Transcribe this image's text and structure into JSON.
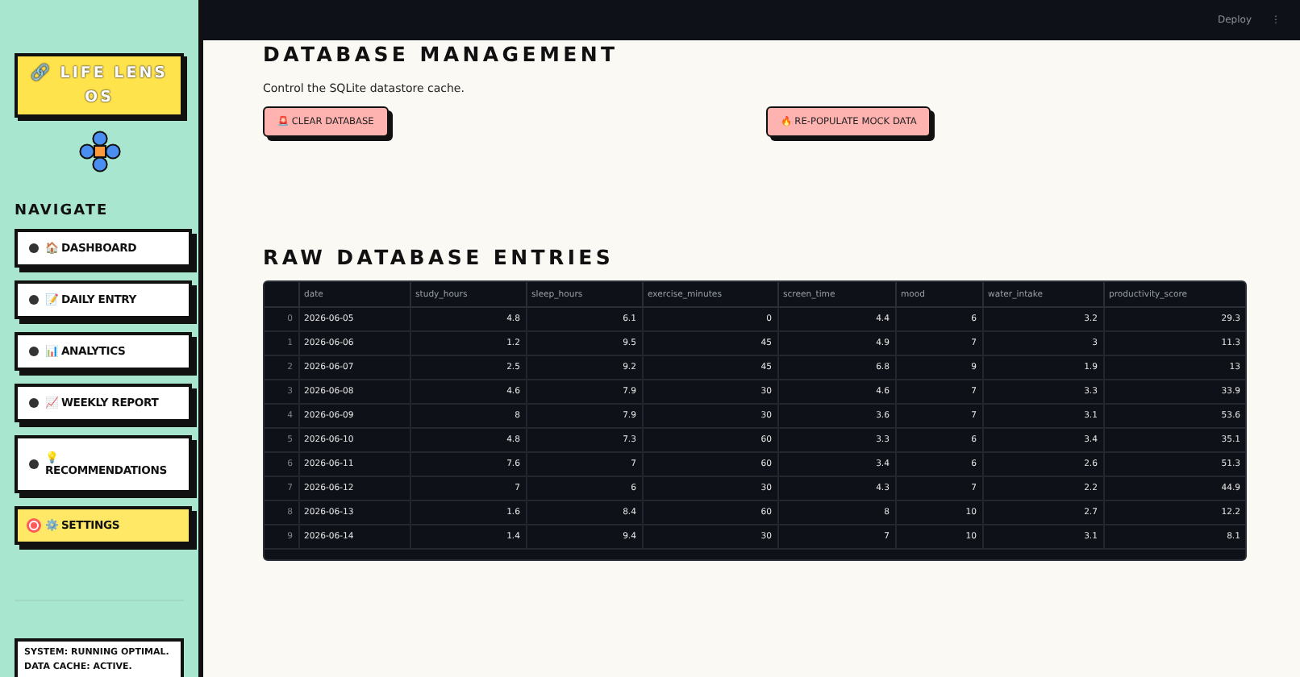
{
  "sidebar": {
    "logo": {
      "icon": "🔗",
      "title": "LIFE LENS OS"
    },
    "section_title": "NAVIGATE",
    "nav_items": [
      {
        "icon": "🏠",
        "label": "DASHBOARD",
        "selected": false
      },
      {
        "icon": "📝",
        "label": "DAILY ENTRY",
        "selected": false
      },
      {
        "icon": "📊",
        "label": "ANALYTICS",
        "selected": false
      },
      {
        "icon": "📈",
        "label": "WEEKLY REPORT",
        "selected": false
      },
      {
        "icon": "💡",
        "label": "RECOMMENDATIONS",
        "selected": false
      },
      {
        "icon": "⚙️",
        "label": "SETTINGS",
        "selected": true
      }
    ],
    "status_lines": [
      "SYSTEM: RUNNING OPTIMAL.",
      "DATA CACHE: ACTIVE."
    ]
  },
  "header": {
    "deploy": "Deploy",
    "menu": "⋮"
  },
  "database_management": {
    "title": "DATABASE MANAGEMENT",
    "subtitle": "Control the SQLite datastore cache.",
    "buttons": [
      {
        "icon": "🚨",
        "label": "CLEAR DATABASE"
      },
      {
        "icon": "🔥",
        "label": "RE-POPULATE MOCK DATA"
      }
    ]
  },
  "raw_entries": {
    "title": "RAW DATABASE ENTRIES",
    "columns": [
      "",
      "date",
      "study_hours",
      "sleep_hours",
      "exercise_minutes",
      "screen_time",
      "mood",
      "water_intake",
      "productivity_score"
    ],
    "rows": [
      [
        "0",
        "2026-06-05",
        "4.8",
        "6.1",
        "0",
        "4.4",
        "6",
        "3.2",
        "29.3"
      ],
      [
        "1",
        "2026-06-06",
        "1.2",
        "9.5",
        "45",
        "4.9",
        "7",
        "3",
        "11.3"
      ],
      [
        "2",
        "2026-06-07",
        "2.5",
        "9.2",
        "45",
        "6.8",
        "9",
        "1.9",
        "13"
      ],
      [
        "3",
        "2026-06-08",
        "4.6",
        "7.9",
        "30",
        "4.6",
        "7",
        "3.3",
        "33.9"
      ],
      [
        "4",
        "2026-06-09",
        "8",
        "7.9",
        "30",
        "3.6",
        "7",
        "3.1",
        "53.6"
      ],
      [
        "5",
        "2026-06-10",
        "4.8",
        "7.3",
        "60",
        "3.3",
        "6",
        "3.4",
        "35.1"
      ],
      [
        "6",
        "2026-06-11",
        "7.6",
        "7",
        "60",
        "3.4",
        "6",
        "2.6",
        "51.3"
      ],
      [
        "7",
        "2026-06-12",
        "7",
        "6",
        "30",
        "4.3",
        "7",
        "2.2",
        "44.9"
      ],
      [
        "8",
        "2026-06-13",
        "1.6",
        "8.4",
        "60",
        "8",
        "10",
        "2.7",
        "12.2"
      ],
      [
        "9",
        "2026-06-14",
        "1.4",
        "9.4",
        "30",
        "7",
        "10",
        "3.1",
        "8.1"
      ]
    ]
  }
}
